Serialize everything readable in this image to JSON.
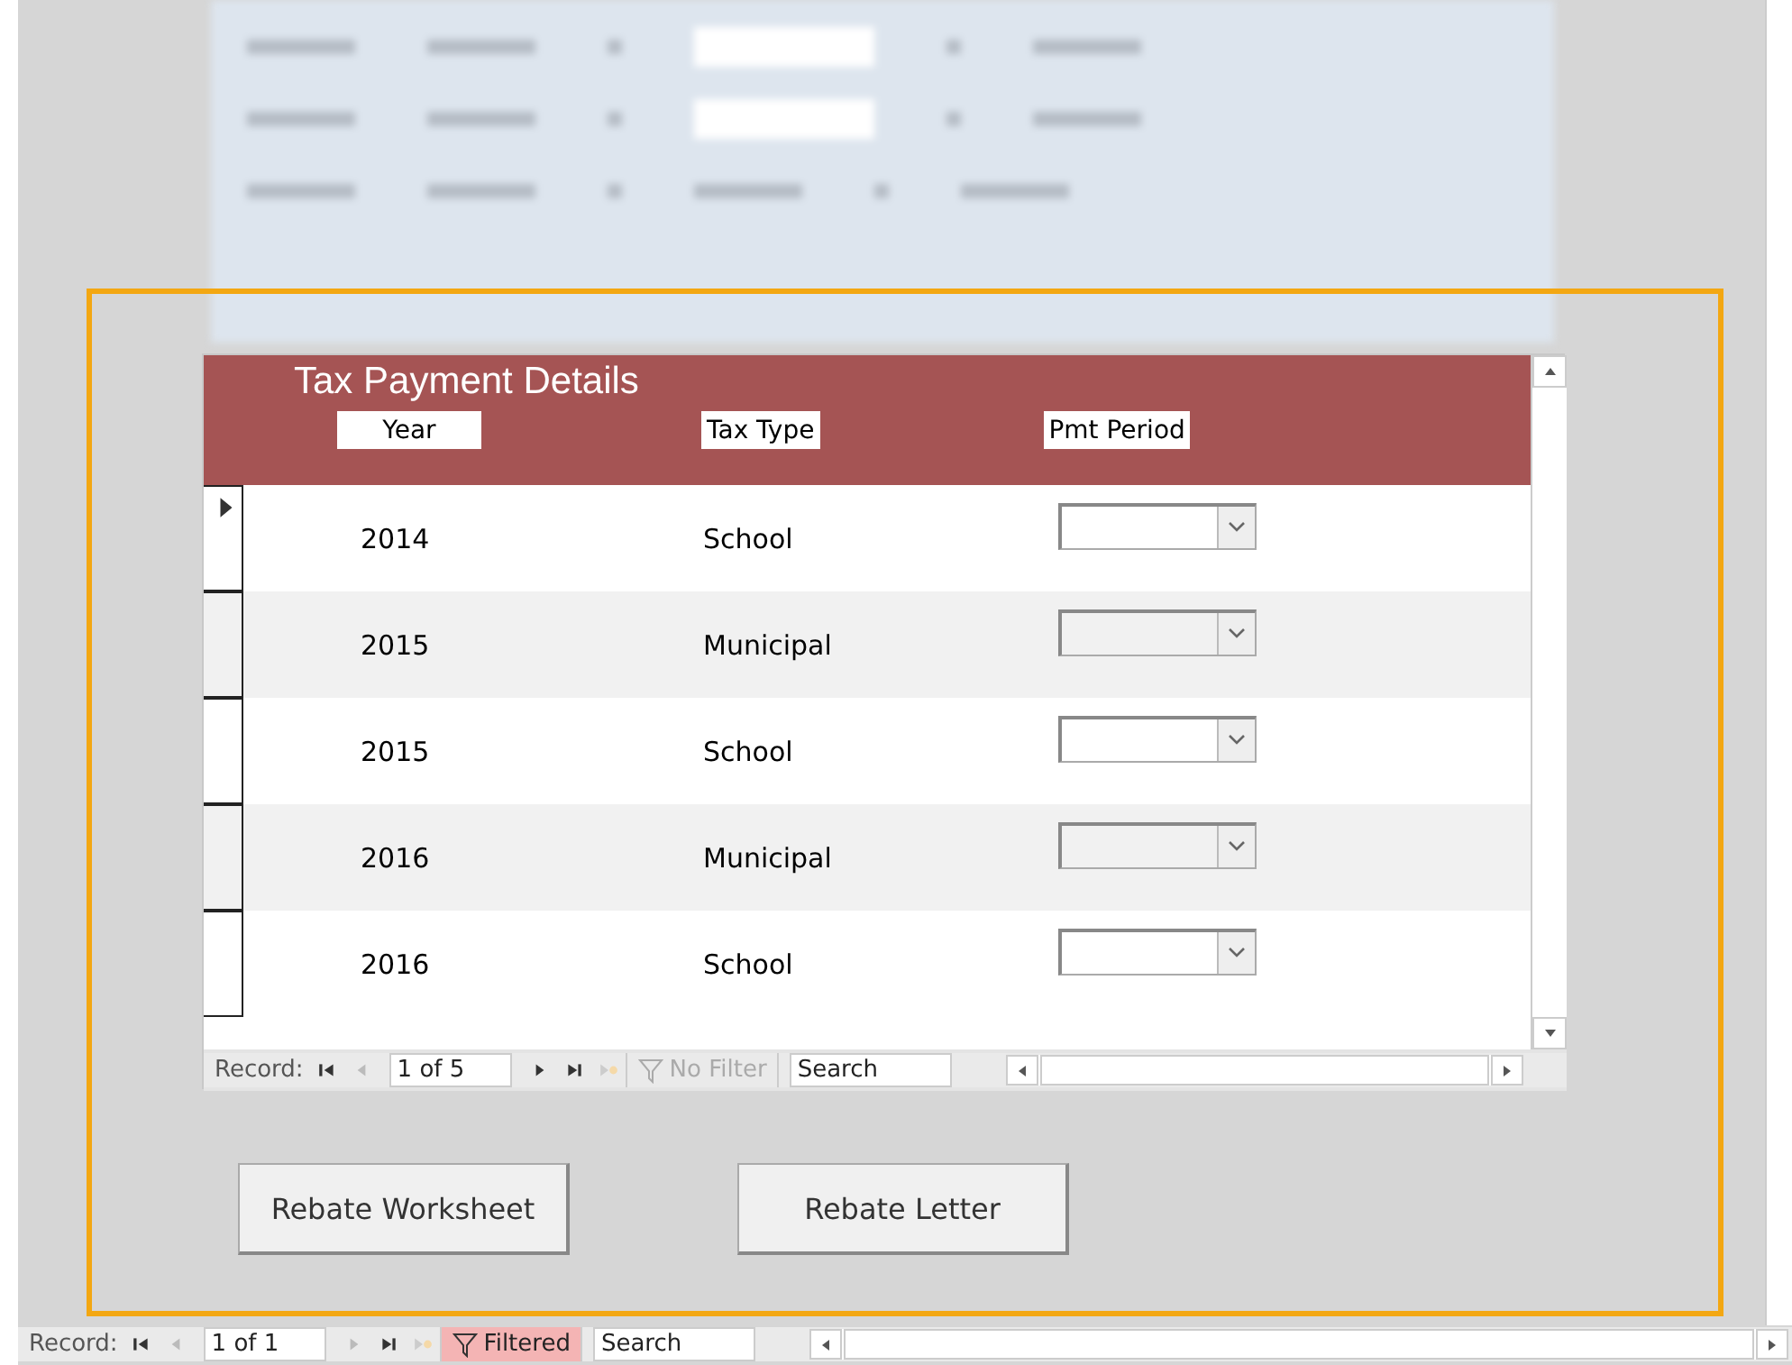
{
  "subform": {
    "title": "Tax Payment Details",
    "columns": [
      "Year",
      "Tax Type",
      "Pmt Period"
    ],
    "rows": [
      {
        "year": "2014",
        "tax_type": "School",
        "selected": true
      },
      {
        "year": "2015",
        "tax_type": "Municipal",
        "selected": false
      },
      {
        "year": "2015",
        "tax_type": "School",
        "selected": false
      },
      {
        "year": "2016",
        "tax_type": "Municipal",
        "selected": false
      },
      {
        "year": "2016",
        "tax_type": "School",
        "selected": false
      }
    ],
    "nav": {
      "label": "Record:",
      "position": "1 of 5",
      "filter": "No Filter",
      "filtered": false,
      "search": "Search"
    }
  },
  "buttons": [
    "Rebate Worksheet",
    "Rebate Letter"
  ],
  "nav": {
    "label": "Record:",
    "position": "1 of 1",
    "filter": "Filtered",
    "filtered": true,
    "search": "Search"
  }
}
